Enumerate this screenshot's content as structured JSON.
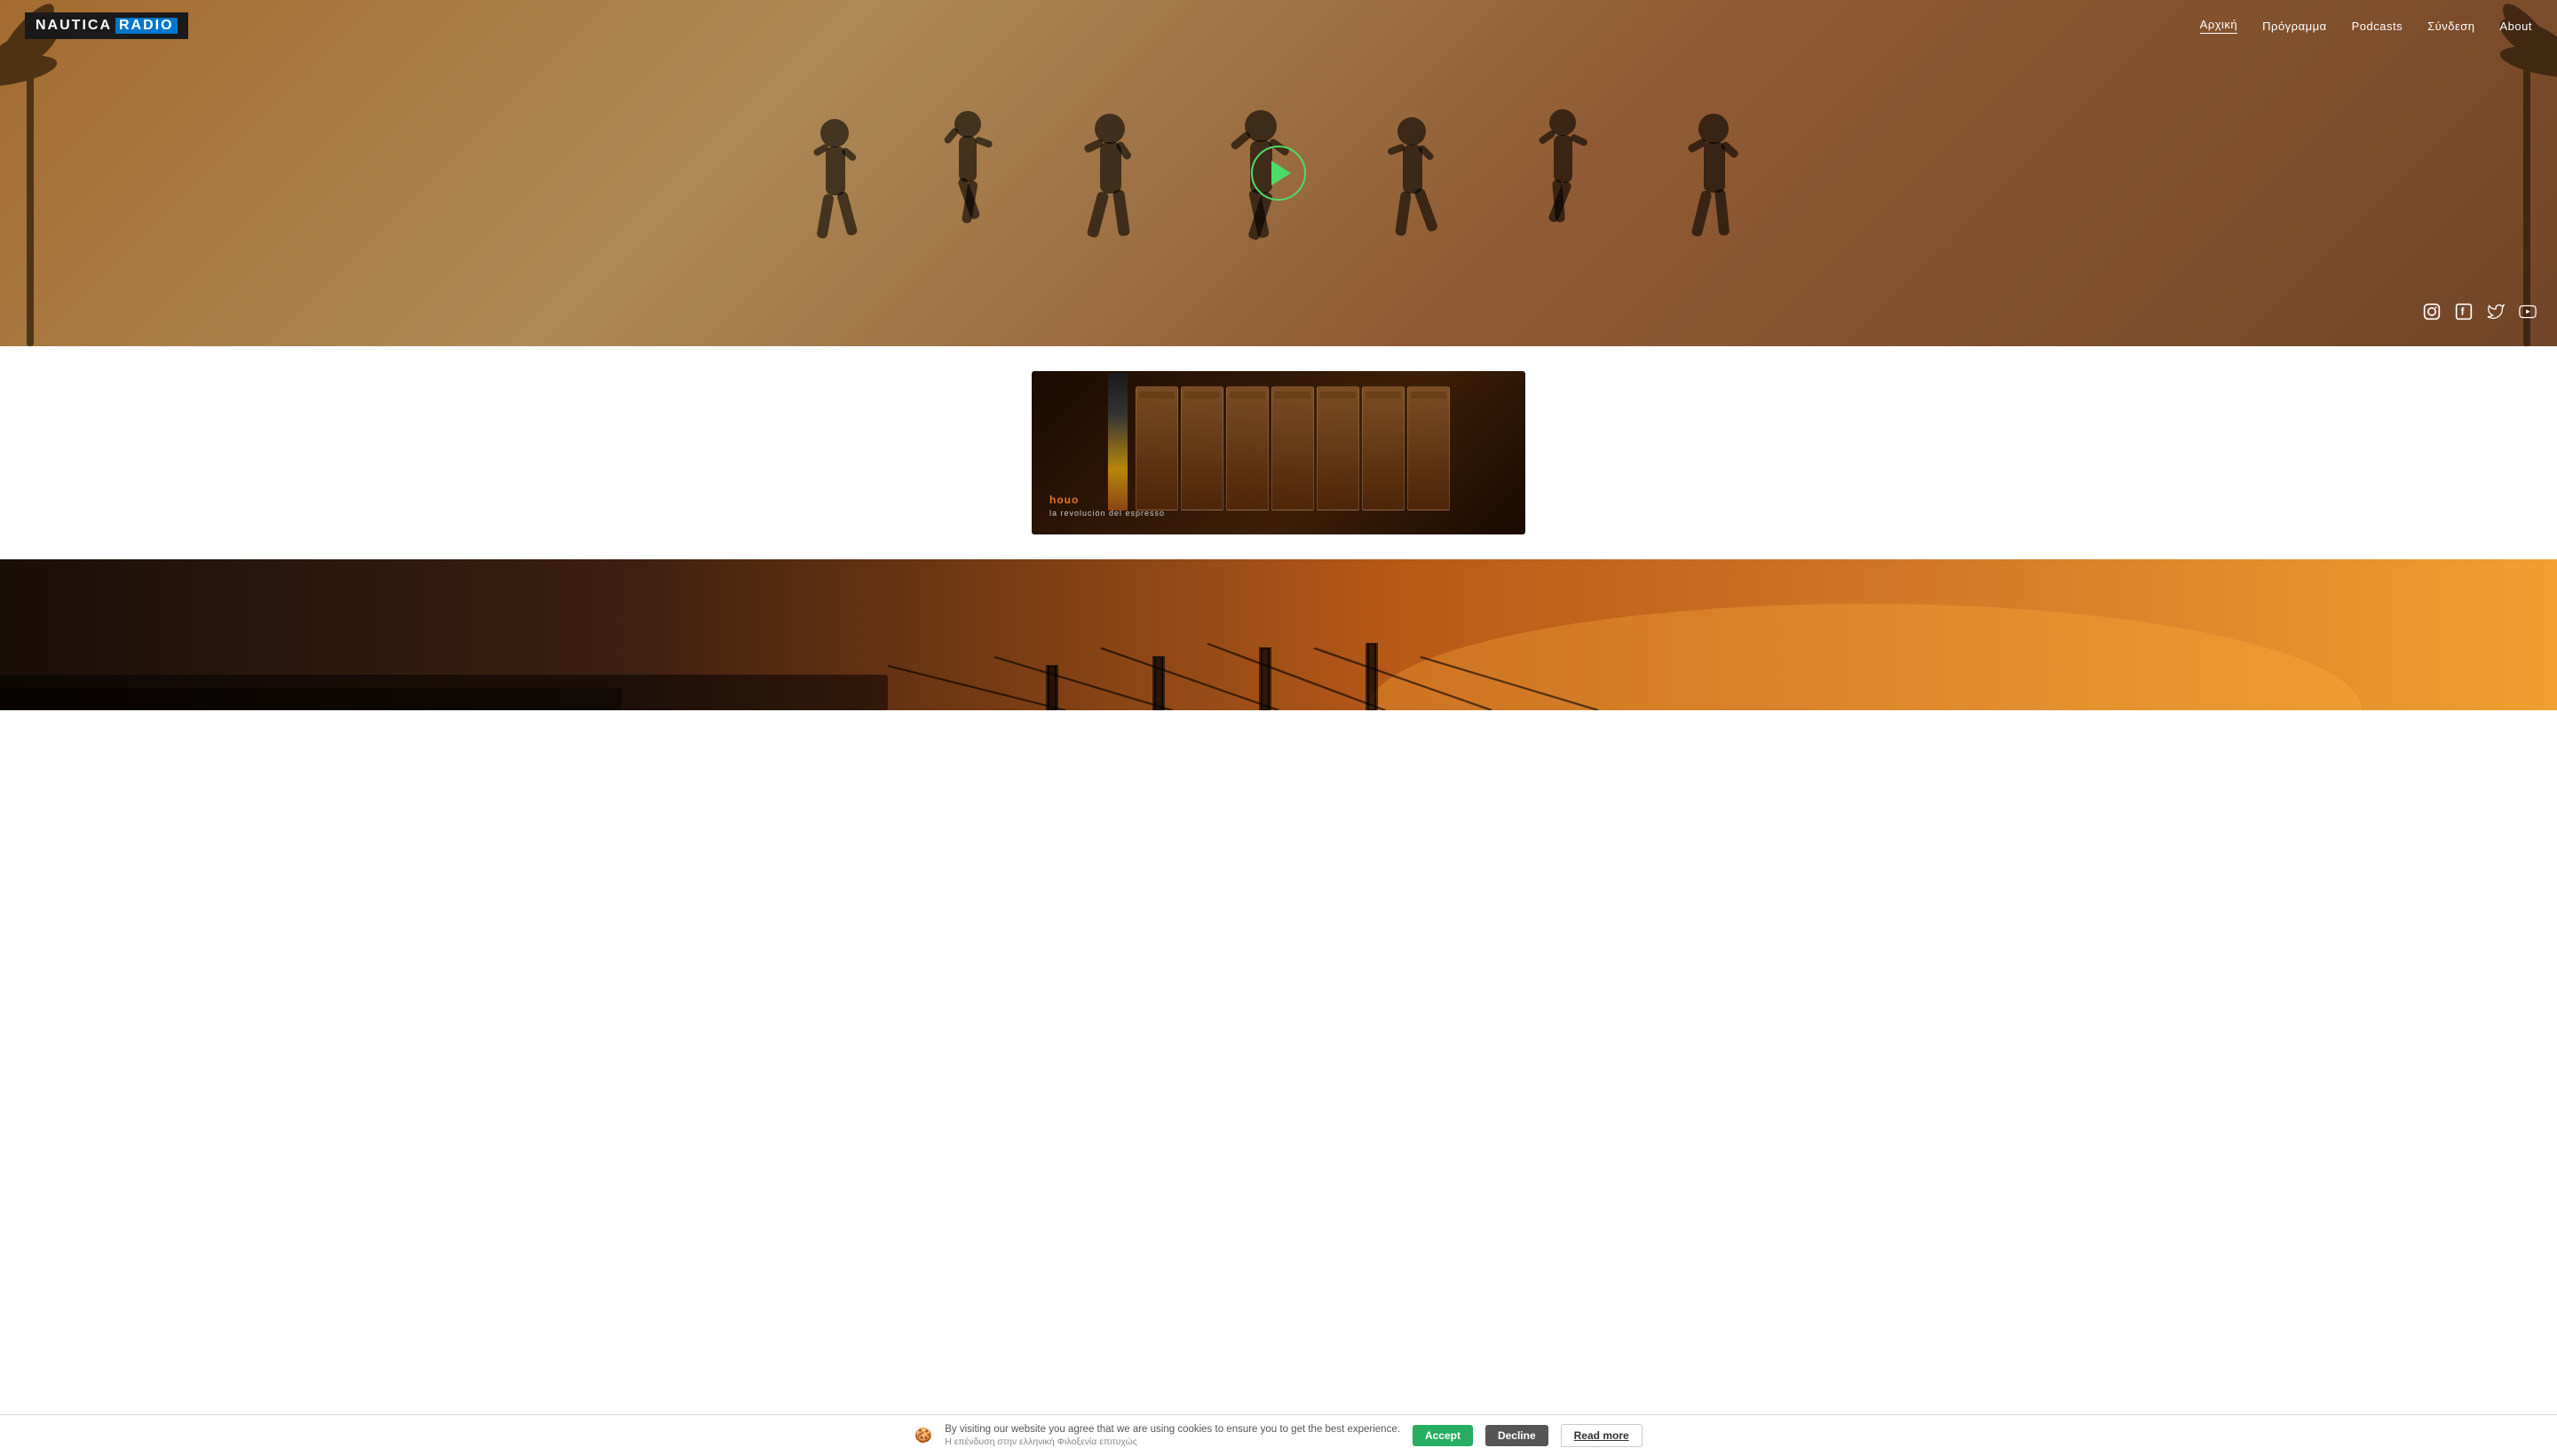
{
  "nav": {
    "home": "Αρχική",
    "program": "Πρόγραμμα",
    "podcasts": "Podcasts",
    "signin": "Σύνδεση",
    "about": "About"
  },
  "logo": {
    "part1": "NAUTICA",
    "part2": "RADIO"
  },
  "hero": {
    "play_label": "Play"
  },
  "social": {
    "instagram": "Instagram",
    "facebook": "Facebook",
    "twitter": "Twitter",
    "youtube": "YouTube"
  },
  "product": {
    "brand": "houo",
    "tagline": "la revolución del espresso"
  },
  "cookie": {
    "icon": "🍪",
    "message": "By visiting our website you agree that we are using cookies to ensure you to get the best experience.",
    "sub_message": "Η επένδυση στην ελληνική Φιλοξενία επιτυχώς",
    "accept": "Accept",
    "decline": "Decline",
    "read_more": "Read more"
  }
}
